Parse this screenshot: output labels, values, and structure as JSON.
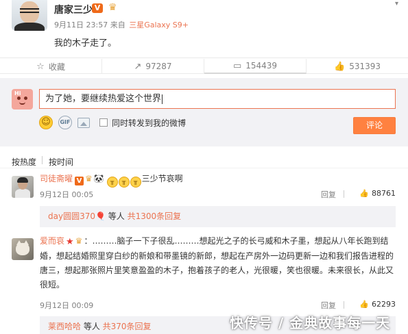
{
  "post": {
    "author": "唐家三少",
    "vip_badge": "V",
    "date": "9月11日 23:57",
    "source_prefix": "来自",
    "source": "三星Galaxy S9+",
    "content": "我的木子走了。",
    "caret_icon": "chevron-down-icon"
  },
  "actions": [
    {
      "icon": "star-icon",
      "glyph": "☆",
      "label": "收藏"
    },
    {
      "icon": "repost-icon",
      "glyph": "↗",
      "label": "97287"
    },
    {
      "icon": "comment-icon",
      "glyph": "▭",
      "label": "154439"
    },
    {
      "icon": "thumbs-up-icon",
      "glyph": "👍",
      "label": "531393"
    }
  ],
  "compose": {
    "input_value": "为了她，要继续热爱这个世界",
    "forward_label": "同时转发到我的微博",
    "submit_label": "评论"
  },
  "sort": {
    "hot_label": "按热度",
    "time_label": "按时间"
  },
  "comments": [
    {
      "name": "司徒斋曜",
      "badge": "V",
      "text": "三少节哀啊",
      "date": "9月12日 00:05",
      "reply_label": "回复",
      "likes": "88761",
      "sub_user": "day圆圆370",
      "sub_mid": " 等人 ",
      "sub_count": "共1300条回复"
    },
    {
      "name": "爱而哀",
      "text": "：………脑子一下子很乱………想起光之子的长弓威和木子墨，想起从八年长跑到结婚，想起结婚照里穿白纱的新娘和带墨镜的新郎，想起在产房外一边码更新一边和我们报告进程的唐三，想起那张照片里笑意盈盈的木子，抱着孩子的老人，光很暖，笑也很暖。未来很长，从此又很短。",
      "date": "9月12日 00:09",
      "reply_label": "回复",
      "likes": "62293",
      "sub_user": "莱西哈哈",
      "sub_mid": " 等人 ",
      "sub_count": "共370条回复"
    }
  ],
  "watermark": "快传号 / 金典故事每一天"
}
